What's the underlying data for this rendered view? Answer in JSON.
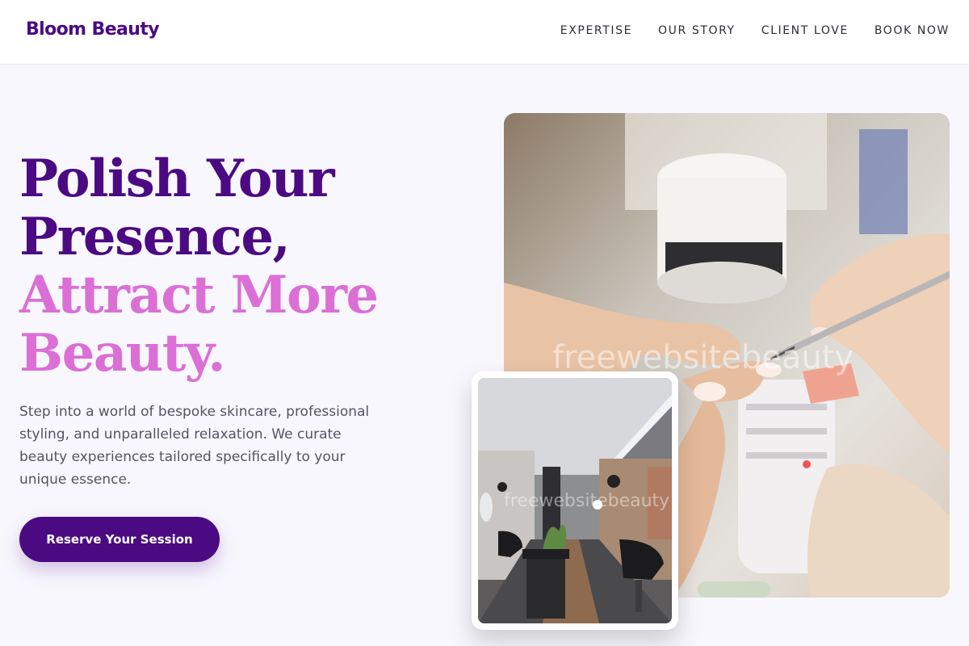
{
  "brand": {
    "name": "Bloom Beauty",
    "color": "#4b0a82",
    "accent": "#db6fd6"
  },
  "nav": {
    "items": [
      "EXPERTISE",
      "OUR STORY",
      "CLIENT LOVE",
      "BOOK NOW"
    ]
  },
  "hero": {
    "title_lines": [
      "Polish Your",
      "Presence,",
      "Attract More",
      "Beauty."
    ],
    "description": "Step into a world of bespoke skincare, professional styling, and unparalleled relaxation. We curate beauty experiences tailored specifically to your unique essence.",
    "cta_label": "Reserve Your Session"
  },
  "images": {
    "main": {
      "watermark": "freewebsitebeauty"
    },
    "inset": {
      "watermark": "freewebsitebeauty"
    }
  }
}
